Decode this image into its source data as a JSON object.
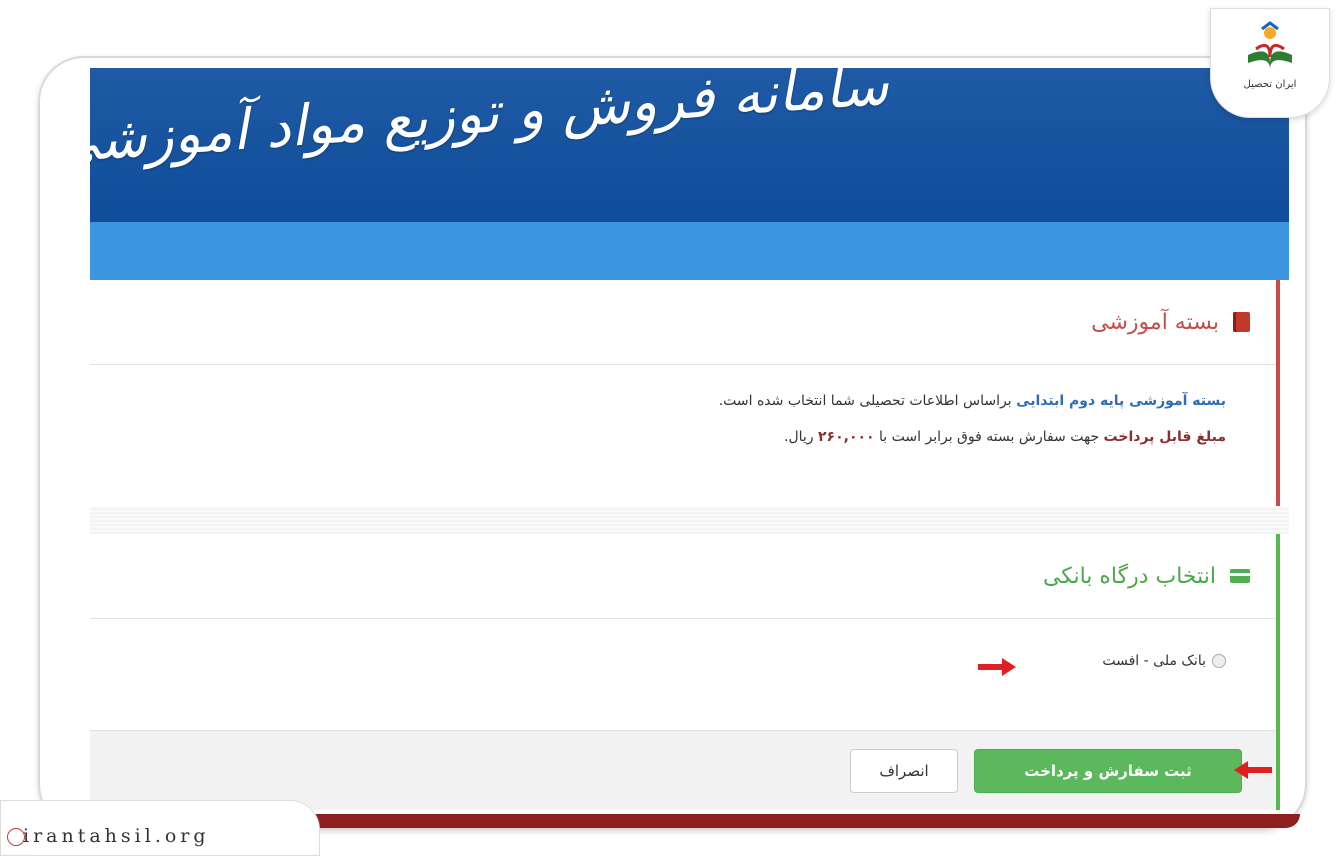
{
  "banner": {
    "title": "سامانه فروش و توزیع مواد آموزشی"
  },
  "package_panel": {
    "title": "بسته آموزشی",
    "line1_strong": "بسته آموزشی پایه دوم ابتدایی",
    "line1_rest": " براساس اطلاعات تحصیلی شما انتخاب شده است.",
    "line2_strong": "مبلغ قابل پرداخت",
    "line2_mid": " جهت سفارش بسته فوق برابر است با ",
    "line2_amount": "۲۶۰,۰۰۰",
    "line2_end": " ریال."
  },
  "gateway_panel": {
    "title": "انتخاب درگاه بانکی",
    "option_label": "بانک ملی - افست"
  },
  "footer": {
    "submit_label": "ثبت سفارش و پرداخت",
    "cancel_label": "انصراف"
  },
  "watermark": {
    "logo_text": "ایران تحصیل",
    "site": "irantahsil.org"
  },
  "colors": {
    "banner": "#1f5aa5",
    "banner_strip": "#3c97e0",
    "package_accent": "#cc4a4a",
    "gateway_accent": "#58b850",
    "primary_button": "#5cb85c",
    "arrow": "#e02020"
  }
}
